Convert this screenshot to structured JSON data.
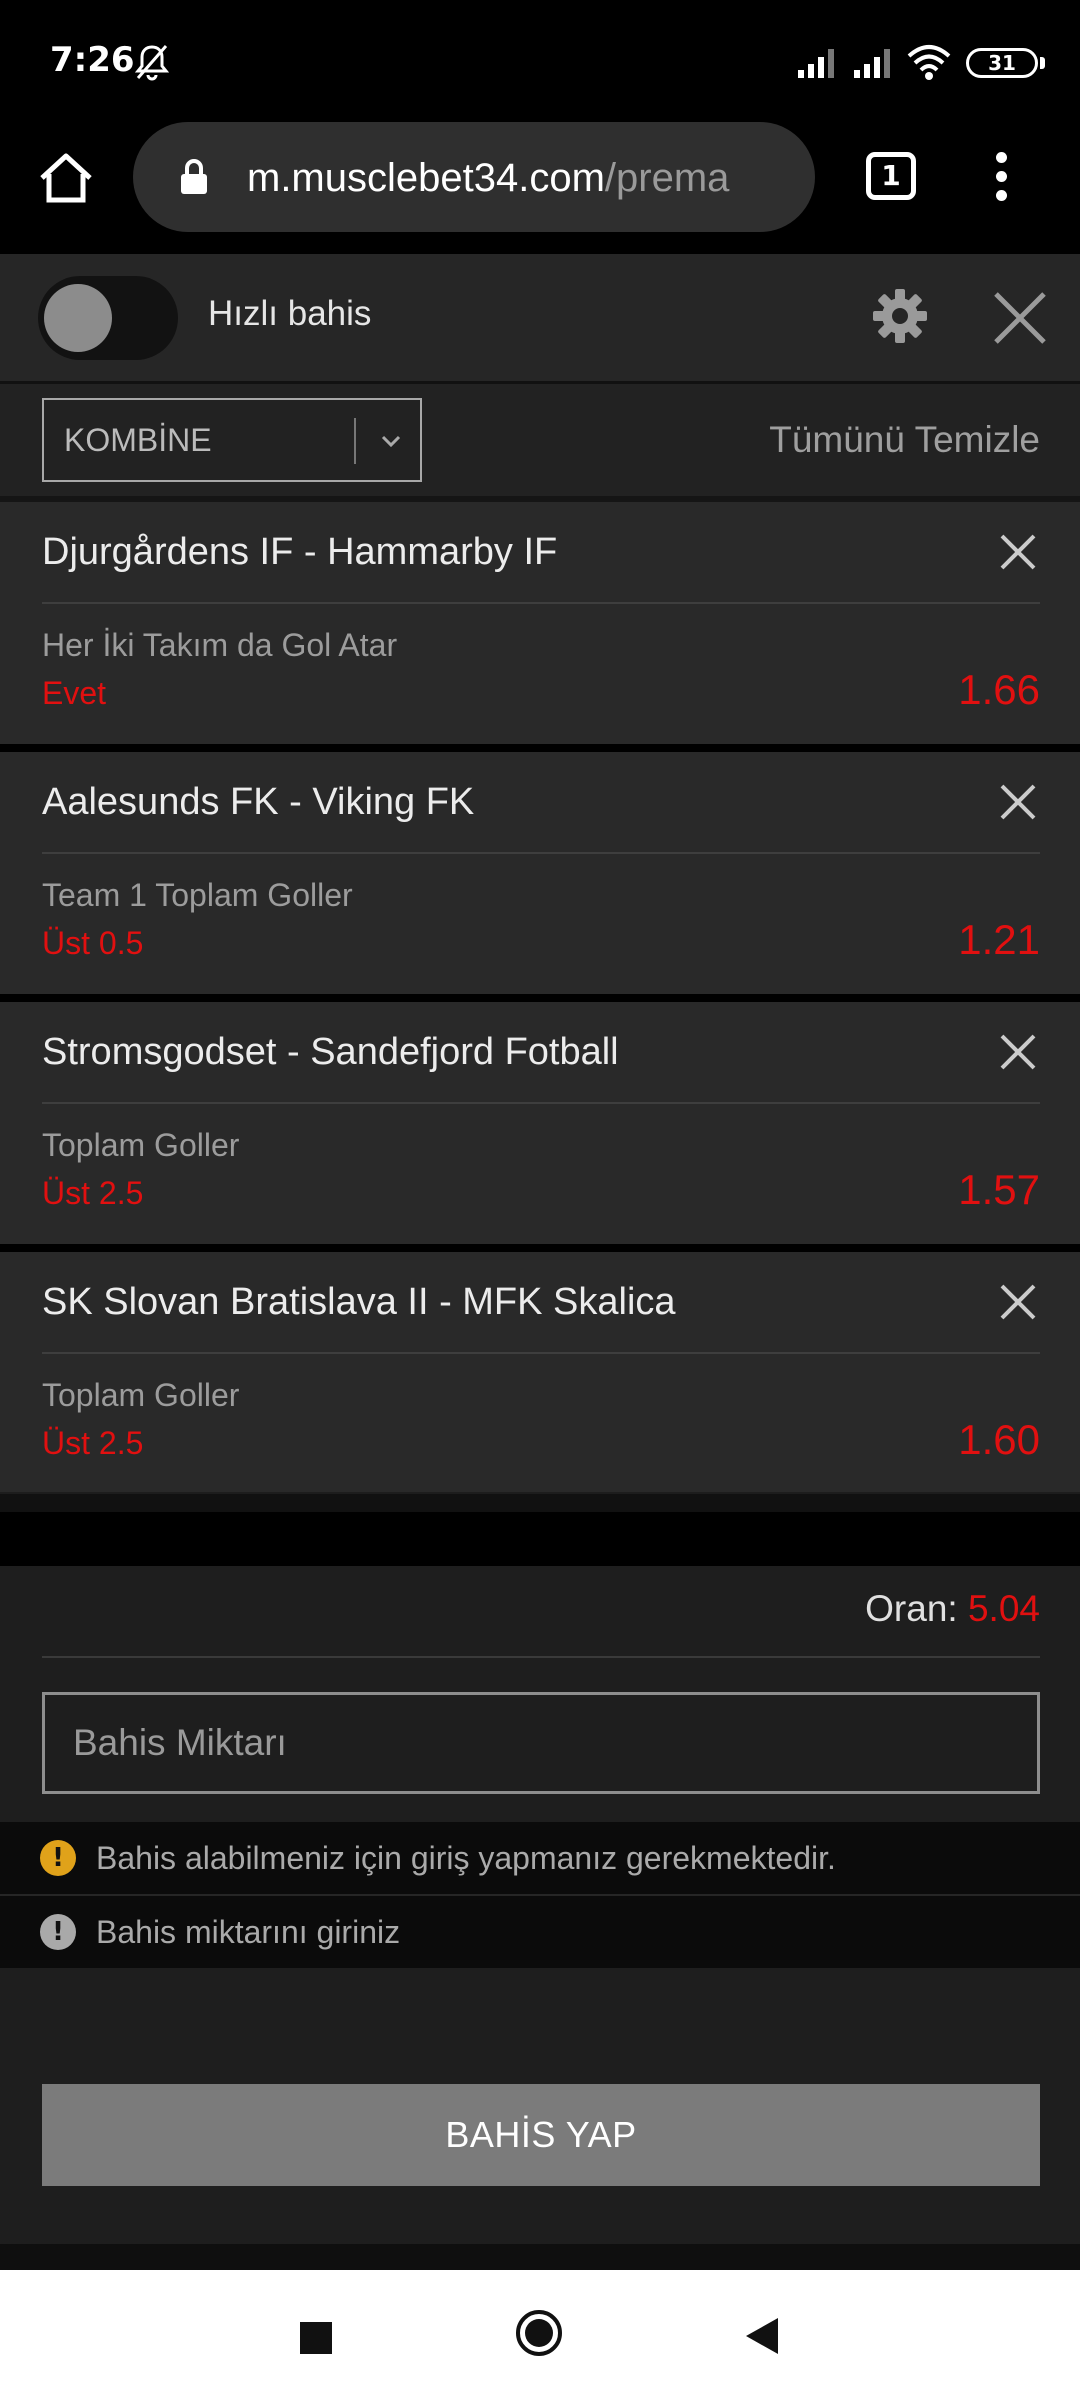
{
  "status_bar": {
    "time": "7:26",
    "battery": "31"
  },
  "browser": {
    "url_domain": "m.musclebet34.com",
    "url_path": "/prema",
    "tab_count": "1"
  },
  "quick_bet": {
    "label": "Hızlı bahis",
    "enabled": false
  },
  "bet_type": {
    "selected": "KOMBİNE"
  },
  "clear_all_label": "Tümünü Temizle",
  "bets": [
    {
      "match": "Djurgårdens IF - Hammarby IF",
      "market": "Her İki Takım da Gol Atar",
      "selection": "Evet",
      "odd": "1.66"
    },
    {
      "match": "Aalesunds FK - Viking FK",
      "market": "Team 1 Toplam Goller",
      "selection": "Üst 0.5",
      "odd": "1.21"
    },
    {
      "match": "Stromsgodset - Sandefjord Fotball",
      "market": "Toplam Goller",
      "selection": "Üst 2.5",
      "odd": "1.57"
    },
    {
      "match": "SK Slovan Bratislava II - MFK Skalica",
      "market": "Toplam Goller",
      "selection": "Üst 2.5",
      "odd": "1.60"
    }
  ],
  "slip": {
    "odds_label": "Oran:",
    "odds_value": "5.04",
    "amount_placeholder": "Bahis Miktarı",
    "warning_login": "Bahis alabilmeniz için giriş yapmanız gerekmektedir.",
    "warning_amount": "Bahis miktarını giriniz",
    "place_bet_label": "BAHİS YAP"
  },
  "colors": {
    "accent_red": "#e11010",
    "panel": "#292929",
    "warning": "#e0a21a"
  }
}
